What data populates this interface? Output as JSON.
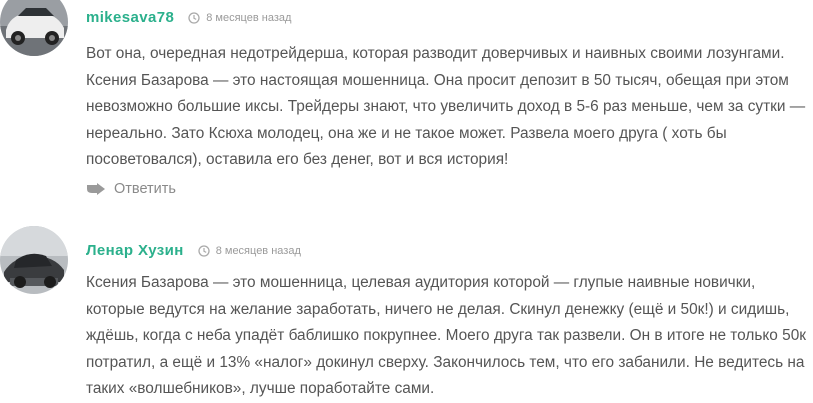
{
  "comments": [
    {
      "author": "mikesava78",
      "time": "8 месяцев назад",
      "avatar_icon": "car-photo-avatar",
      "text": "Вот она, очередная недотрейдерша, которая разводит доверчивых и наивных своими лозунгами. Ксения Базарова — это настоящая мошенница. Она просит депозит в 50 тысяч, обещая при этом невозможно большие иксы. Трейдеры знают, что увеличить доход в 5-6 раз меньше, чем за сутки — нереально. Зато Ксюха молодец, она же и не такое может. Развела моего друга ( хоть бы посоветовался), оставила его без денег, вот и вся история!",
      "reply_label": "Ответить"
    },
    {
      "author": "Ленар Хузин",
      "time": "8 месяцев назад",
      "avatar_icon": "dark-photo-avatar",
      "text": "Ксения Базарова — это мошенница, целевая аудитория которой — глупые наивные новички, которые ведутся на желание заработать, ничего не делая. Скинул денежку (ещё и 50к!) и сидишь, ждёшь, когда с неба упадёт баблишко покрупнее. Моего друга так развели. Он в итоге не только 50к потратил, а ещё и 13% «налог» докинул сверху. Закончилось тем, что его забанили. Не ведитесь на таких «волшебников», лучше поработайте сами."
    }
  ],
  "colors": {
    "author": "#2bb08c",
    "text": "#555555",
    "meta": "#9a9a9a"
  }
}
